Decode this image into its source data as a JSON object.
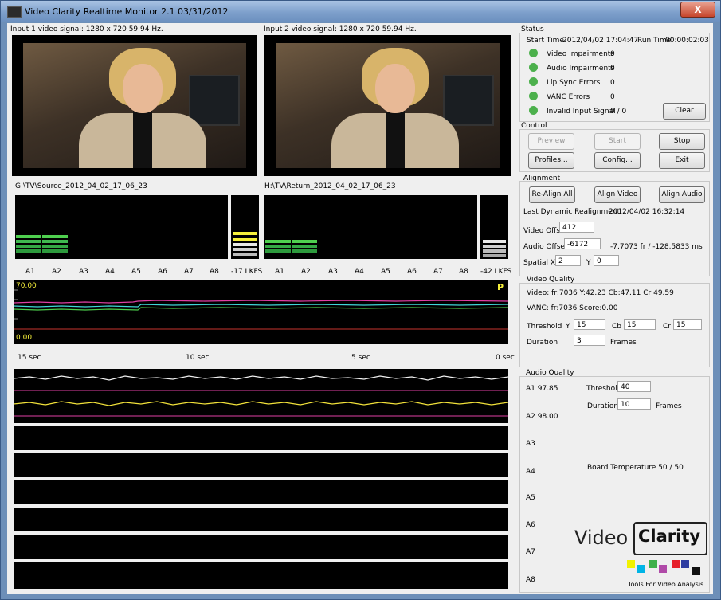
{
  "window": {
    "title": "Video Clarity Realtime Monitor 2.1 03/31/2012",
    "close_label": "X"
  },
  "inputs": {
    "input1_label": "Input 1 video signal: 1280 x 720 59.94 Hz.",
    "input2_label": "Input 2 video signal: 1280 x 720 59.94 Hz.",
    "source_path": "G:\\TV\\Source_2012_04_02_17_06_23",
    "return_path": "H:\\TV\\Return_2012_04_02_17_06_23"
  },
  "meters": {
    "channels": [
      "A1",
      "A2",
      "A3",
      "A4",
      "A5",
      "A6",
      "A7",
      "A8"
    ],
    "loudness_left": "-17 LKFS",
    "loudness_right": "-42 LKFS"
  },
  "graph": {
    "top_label": "70.00",
    "bottom_label": "0.00",
    "marker": "P",
    "time_labels": [
      "15 sec",
      "10 sec",
      "5 sec",
      "0 sec"
    ]
  },
  "status": {
    "title": "Status",
    "start_time_label": "Start Time",
    "start_time": "2012/04/02 17:04:47",
    "run_time_label": "Run Time",
    "run_time": "00:00:02:03",
    "items": [
      {
        "label": "Video Impairments",
        "value": "0"
      },
      {
        "label": "Audio Impairments",
        "value": "0"
      },
      {
        "label": "Lip Sync Errors",
        "value": "0"
      },
      {
        "label": "VANC Errors",
        "value": "0"
      },
      {
        "label": "Invalid Input Signal",
        "value": "0 / 0"
      }
    ],
    "clear_label": "Clear",
    "indicator_color": "#4cb04c"
  },
  "control": {
    "title": "Control",
    "preview_label": "Preview",
    "start_label": "Start",
    "stop_label": "Stop",
    "profiles_label": "Profiles...",
    "config_label": "Config...",
    "exit_label": "Exit"
  },
  "alignment": {
    "title": "Alignment",
    "realign_all_label": "Re-Align All",
    "align_video_label": "Align Video",
    "align_audio_label": "Align Audio",
    "last_realignment_label": "Last Dynamic Realignment",
    "last_realignment": "2012/04/02 16:32:14",
    "video_offset_label": "Video Offset",
    "video_offset": "412",
    "audio_offset_label": "Audio Offset",
    "audio_offset": "-6172",
    "audio_offset_readout": "-7.7073 fr / -128.5833 ms",
    "spatial_x_label": "Spatial X",
    "spatial_x": "2",
    "y_label": "Y",
    "spatial_y": "0"
  },
  "video_quality": {
    "title": "Video Quality",
    "video_readout": "Video:  fr:7036  Y:42.23  Cb:47.11  Cr:49.59",
    "vanc_readout": "VANC:  fr:7036  Score:0.00",
    "threshold_label": "Threshold",
    "y_label": "Y",
    "y_value": "15",
    "cb_label": "Cb",
    "cb_value": "15",
    "cr_label": "Cr",
    "cr_value": "15",
    "duration_label": "Duration",
    "duration_value": "3",
    "frames_label": "Frames"
  },
  "audio_quality": {
    "title": "Audio Quality",
    "a1_readout": "A1 97.85",
    "a2_readout": "A2 98.00",
    "threshold_label": "Threshold",
    "threshold_value": "40",
    "duration_label": "Duration",
    "duration_value": "10",
    "frames_label": "Frames",
    "channel_labels": [
      "A3",
      "A4",
      "A5",
      "A6",
      "A7",
      "A8"
    ],
    "board_temperature": "Board Temperature  50 / 50"
  },
  "logo": {
    "word1": "Video",
    "word2": "Clarity",
    "tagline": "Tools For Video Analysis",
    "colors": [
      "#f2f200",
      "#00b4e6",
      "#3fb04a",
      "#b04aa8",
      "#e6202a",
      "#2d3ca0",
      "#111111"
    ]
  }
}
